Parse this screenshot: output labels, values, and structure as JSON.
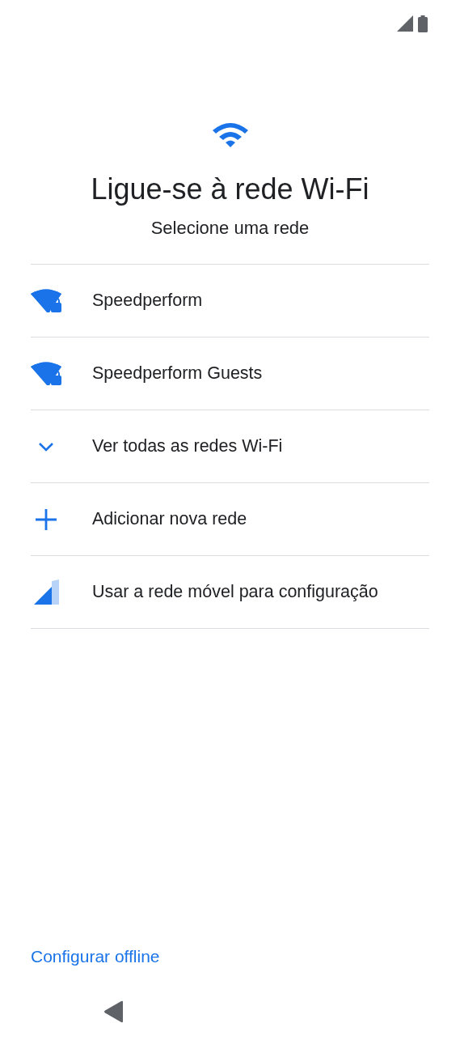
{
  "title": "Ligue-se à rede Wi-Fi",
  "subtitle": "Selecione uma rede",
  "items": [
    {
      "kind": "network",
      "label": "Speedperform"
    },
    {
      "kind": "network",
      "label": "Speedperform Guests"
    },
    {
      "kind": "expand",
      "label": "Ver todas as redes Wi-Fi"
    },
    {
      "kind": "add",
      "label": "Adicionar nova rede"
    },
    {
      "kind": "mobile",
      "label": "Usar a rede móvel para configuração"
    }
  ],
  "footer_link": "Configurar offline"
}
